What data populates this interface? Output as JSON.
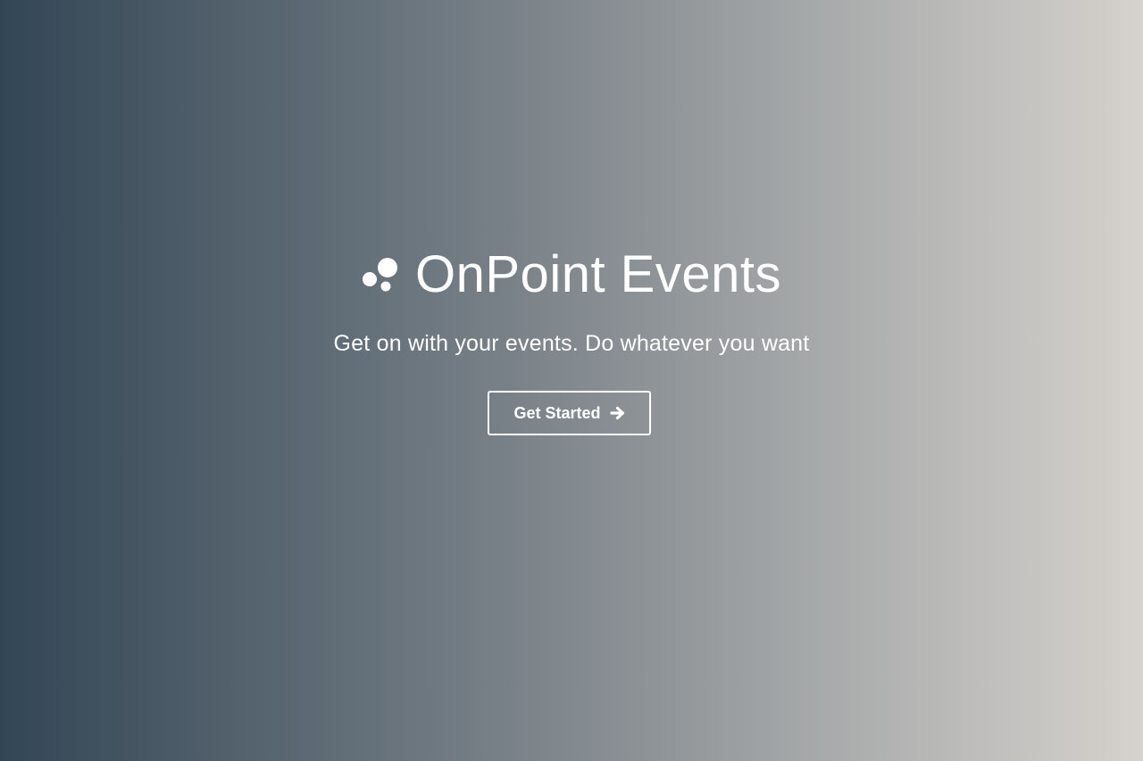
{
  "brand": {
    "name": "OnPoint Events",
    "logo_icon": "bubbles-icon"
  },
  "hero": {
    "tagline": "Get on with your events. Do whatever you want",
    "cta_label": "Get Started",
    "cta_icon": "arrow-right-icon"
  },
  "colors": {
    "gradient_start": "#334655",
    "gradient_end": "#d6d2cd",
    "foreground": "#ffffff"
  }
}
